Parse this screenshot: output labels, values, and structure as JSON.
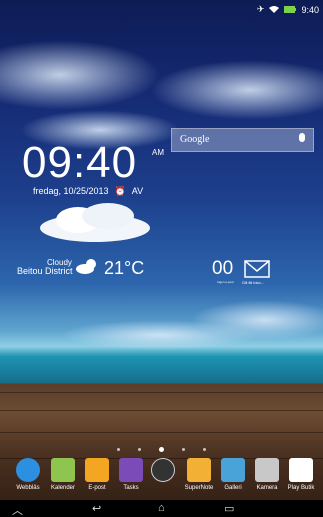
{
  "status": {
    "time": "9:40"
  },
  "search": {
    "label": "Google"
  },
  "clock": {
    "time": "09:40",
    "ampm": "AM",
    "date": "fredag, 10/25/2013",
    "alarm_label": "AV"
  },
  "weather": {
    "condition": "Cloudy",
    "city": "Beitou District",
    "temperature": "21°C"
  },
  "mail": {
    "count": "00",
    "status_label": "Ingen e-post",
    "sublabel": "Gå till inko..."
  },
  "dock": {
    "apps": [
      {
        "name": "Webbläs",
        "icon": "globe-icon",
        "color": "#2d8fe0"
      },
      {
        "name": "Kalender",
        "icon": "calendar-icon",
        "color": "#8fc44f"
      },
      {
        "name": "E-post",
        "icon": "envelope-icon",
        "color": "#f4a623"
      },
      {
        "name": "Tasks",
        "icon": "checkbox-icon",
        "color": "#7b4bb8"
      },
      {
        "name": "",
        "icon": "apps-grid-icon",
        "color": "#333333"
      },
      {
        "name": "SuperNote",
        "icon": "notebook-icon",
        "color": "#f2b134"
      },
      {
        "name": "Galleri",
        "icon": "gallery-icon",
        "color": "#4aa3d8"
      },
      {
        "name": "Kamera",
        "icon": "camera-icon",
        "color": "#c8c8c8"
      },
      {
        "name": "Play Butik",
        "icon": "play-store-icon",
        "color": "#ffffff"
      }
    ]
  },
  "colors": {
    "accent": "#1d3f8c",
    "battery": "#7cd34a"
  }
}
